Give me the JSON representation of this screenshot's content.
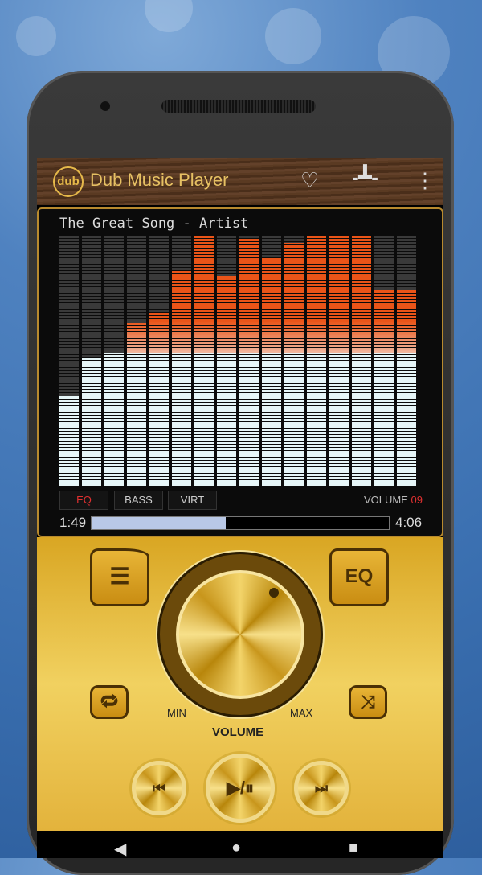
{
  "app": {
    "logo_text": "dub",
    "title": "Dub Music Player"
  },
  "header_icons": [
    "heart-icon",
    "equalizer-slider-icon",
    "more-vert-icon"
  ],
  "now_playing": {
    "song": "The Great Song - Artist",
    "elapsed": "1:49",
    "duration": "4:06",
    "progress": 0.45
  },
  "spectrum": {
    "levels": [
      0.36,
      0.51,
      0.53,
      0.65,
      0.69,
      0.86,
      1.0,
      0.84,
      0.99,
      0.91,
      0.97,
      1.0,
      1.0,
      1.0,
      0.78,
      0.78
    ],
    "colors": {
      "low": "#e6f6f8",
      "high": "#ea5418",
      "off": "#3a3a3a"
    }
  },
  "effects": [
    {
      "label": "EQ",
      "active": true
    },
    {
      "label": "BASS",
      "active": false
    },
    {
      "label": "VIRT",
      "active": false
    }
  ],
  "volume": {
    "label": "VOLUME",
    "value": "09",
    "value_color": "#e03030"
  },
  "controls": {
    "eq_label": "EQ",
    "min_label": "MIN",
    "max_label": "MAX",
    "knob_label": "VOLUME",
    "prev": "⏮",
    "play_pause": "▶/⏸",
    "next": "⏭"
  },
  "nav": {
    "back": "◀",
    "home": "●",
    "recents": "■"
  }
}
